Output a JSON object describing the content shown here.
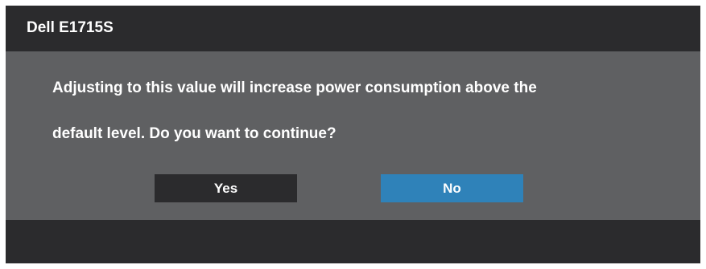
{
  "dialog": {
    "title": "Dell E1715S",
    "message_line_1": "Adjusting to this value will increase power consumption above the",
    "message_line_2": "default level. Do you want to continue?",
    "yes_label": "Yes",
    "no_label": "No"
  },
  "colors": {
    "dark_panel": "#2b2b2d",
    "body_panel": "#5f6062",
    "selected_button": "#2f82b9",
    "text": "#ffffff"
  }
}
